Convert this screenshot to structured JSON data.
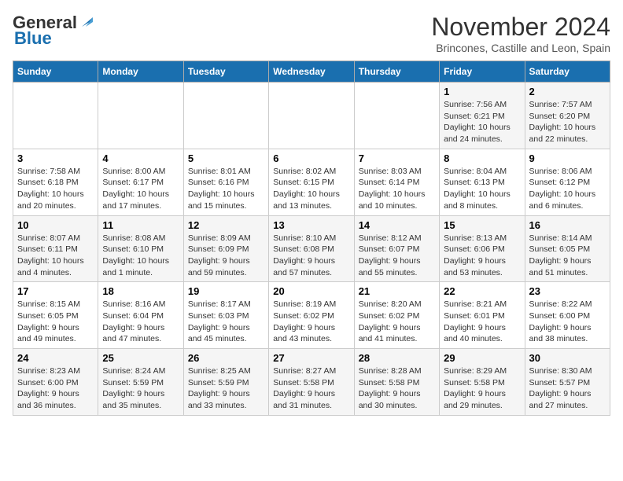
{
  "logo": {
    "line1": "General",
    "line2": "Blue"
  },
  "title": "November 2024",
  "subtitle": "Brincones, Castille and Leon, Spain",
  "headers": [
    "Sunday",
    "Monday",
    "Tuesday",
    "Wednesday",
    "Thursday",
    "Friday",
    "Saturday"
  ],
  "weeks": [
    [
      {
        "day": "",
        "info": ""
      },
      {
        "day": "",
        "info": ""
      },
      {
        "day": "",
        "info": ""
      },
      {
        "day": "",
        "info": ""
      },
      {
        "day": "",
        "info": ""
      },
      {
        "day": "1",
        "info": "Sunrise: 7:56 AM\nSunset: 6:21 PM\nDaylight: 10 hours\nand 24 minutes."
      },
      {
        "day": "2",
        "info": "Sunrise: 7:57 AM\nSunset: 6:20 PM\nDaylight: 10 hours\nand 22 minutes."
      }
    ],
    [
      {
        "day": "3",
        "info": "Sunrise: 7:58 AM\nSunset: 6:18 PM\nDaylight: 10 hours\nand 20 minutes."
      },
      {
        "day": "4",
        "info": "Sunrise: 8:00 AM\nSunset: 6:17 PM\nDaylight: 10 hours\nand 17 minutes."
      },
      {
        "day": "5",
        "info": "Sunrise: 8:01 AM\nSunset: 6:16 PM\nDaylight: 10 hours\nand 15 minutes."
      },
      {
        "day": "6",
        "info": "Sunrise: 8:02 AM\nSunset: 6:15 PM\nDaylight: 10 hours\nand 13 minutes."
      },
      {
        "day": "7",
        "info": "Sunrise: 8:03 AM\nSunset: 6:14 PM\nDaylight: 10 hours\nand 10 minutes."
      },
      {
        "day": "8",
        "info": "Sunrise: 8:04 AM\nSunset: 6:13 PM\nDaylight: 10 hours\nand 8 minutes."
      },
      {
        "day": "9",
        "info": "Sunrise: 8:06 AM\nSunset: 6:12 PM\nDaylight: 10 hours\nand 6 minutes."
      }
    ],
    [
      {
        "day": "10",
        "info": "Sunrise: 8:07 AM\nSunset: 6:11 PM\nDaylight: 10 hours\nand 4 minutes."
      },
      {
        "day": "11",
        "info": "Sunrise: 8:08 AM\nSunset: 6:10 PM\nDaylight: 10 hours\nand 1 minute."
      },
      {
        "day": "12",
        "info": "Sunrise: 8:09 AM\nSunset: 6:09 PM\nDaylight: 9 hours\nand 59 minutes."
      },
      {
        "day": "13",
        "info": "Sunrise: 8:10 AM\nSunset: 6:08 PM\nDaylight: 9 hours\nand 57 minutes."
      },
      {
        "day": "14",
        "info": "Sunrise: 8:12 AM\nSunset: 6:07 PM\nDaylight: 9 hours\nand 55 minutes."
      },
      {
        "day": "15",
        "info": "Sunrise: 8:13 AM\nSunset: 6:06 PM\nDaylight: 9 hours\nand 53 minutes."
      },
      {
        "day": "16",
        "info": "Sunrise: 8:14 AM\nSunset: 6:05 PM\nDaylight: 9 hours\nand 51 minutes."
      }
    ],
    [
      {
        "day": "17",
        "info": "Sunrise: 8:15 AM\nSunset: 6:05 PM\nDaylight: 9 hours\nand 49 minutes."
      },
      {
        "day": "18",
        "info": "Sunrise: 8:16 AM\nSunset: 6:04 PM\nDaylight: 9 hours\nand 47 minutes."
      },
      {
        "day": "19",
        "info": "Sunrise: 8:17 AM\nSunset: 6:03 PM\nDaylight: 9 hours\nand 45 minutes."
      },
      {
        "day": "20",
        "info": "Sunrise: 8:19 AM\nSunset: 6:02 PM\nDaylight: 9 hours\nand 43 minutes."
      },
      {
        "day": "21",
        "info": "Sunrise: 8:20 AM\nSunset: 6:02 PM\nDaylight: 9 hours\nand 41 minutes."
      },
      {
        "day": "22",
        "info": "Sunrise: 8:21 AM\nSunset: 6:01 PM\nDaylight: 9 hours\nand 40 minutes."
      },
      {
        "day": "23",
        "info": "Sunrise: 8:22 AM\nSunset: 6:00 PM\nDaylight: 9 hours\nand 38 minutes."
      }
    ],
    [
      {
        "day": "24",
        "info": "Sunrise: 8:23 AM\nSunset: 6:00 PM\nDaylight: 9 hours\nand 36 minutes."
      },
      {
        "day": "25",
        "info": "Sunrise: 8:24 AM\nSunset: 5:59 PM\nDaylight: 9 hours\nand 35 minutes."
      },
      {
        "day": "26",
        "info": "Sunrise: 8:25 AM\nSunset: 5:59 PM\nDaylight: 9 hours\nand 33 minutes."
      },
      {
        "day": "27",
        "info": "Sunrise: 8:27 AM\nSunset: 5:58 PM\nDaylight: 9 hours\nand 31 minutes."
      },
      {
        "day": "28",
        "info": "Sunrise: 8:28 AM\nSunset: 5:58 PM\nDaylight: 9 hours\nand 30 minutes."
      },
      {
        "day": "29",
        "info": "Sunrise: 8:29 AM\nSunset: 5:58 PM\nDaylight: 9 hours\nand 29 minutes."
      },
      {
        "day": "30",
        "info": "Sunrise: 8:30 AM\nSunset: 5:57 PM\nDaylight: 9 hours\nand 27 minutes."
      }
    ]
  ]
}
